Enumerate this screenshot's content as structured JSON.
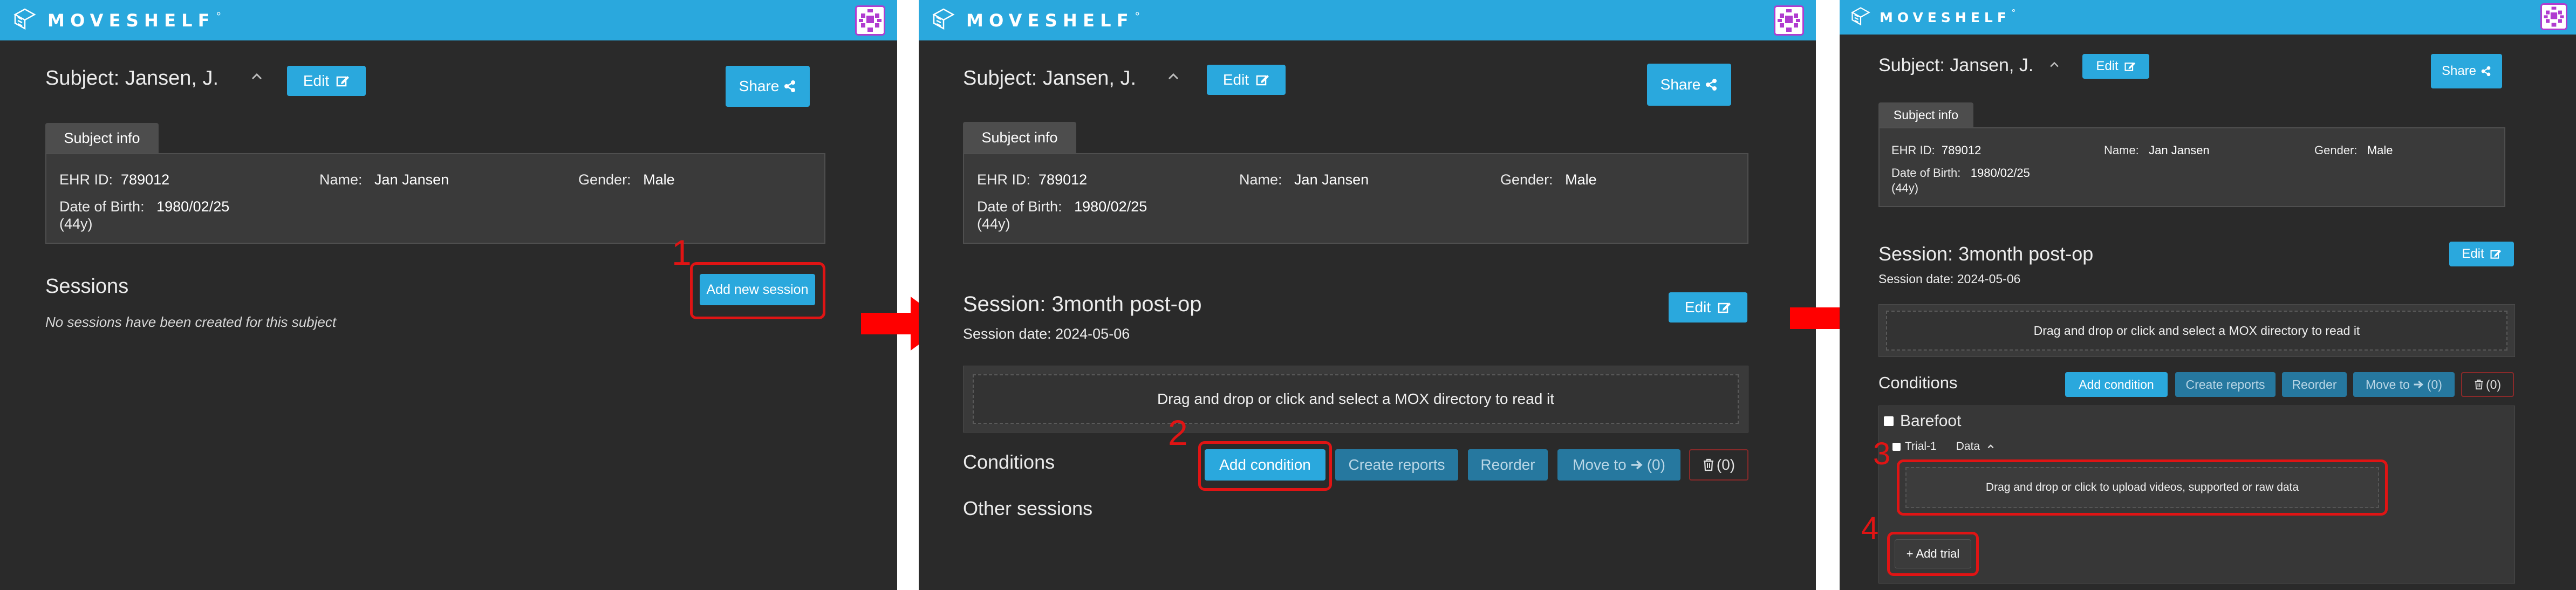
{
  "app": {
    "brand": "MOVESHELF",
    "brand_mark": "°"
  },
  "icons": {
    "logo": "moveshelf-logo-icon",
    "edit": "edit-icon",
    "share": "share-icon",
    "collapse": "chevron-up-icon",
    "arrow": "arrow-right-icon",
    "trash": "trash-icon"
  },
  "colors": {
    "navbar": "#2aa8dd",
    "background": "#2a2a2a",
    "highlight": "#e01414"
  },
  "panel1": {
    "subject_title": "Subject: Jansen, J.",
    "edit_label": "Edit",
    "share_label": "Share",
    "tab_label": "Subject info",
    "info": {
      "ehr_label": "EHR ID:",
      "ehr_value": "789012",
      "name_label": "Name:",
      "name_value": "Jan Jansen",
      "gender_label": "Gender:",
      "gender_value": "Male",
      "dob_label": "Date of Birth:",
      "dob_value": "1980/02/25",
      "age": "(44y)"
    },
    "sessions_heading": "Sessions",
    "no_sessions": "No sessions have been created for this subject",
    "add_session_label": "Add new session",
    "step": "1"
  },
  "panel2": {
    "subject_title": "Subject: Jansen, J.",
    "edit_label": "Edit",
    "share_label": "Share",
    "tab_label": "Subject info",
    "info": {
      "ehr_label": "EHR ID:",
      "ehr_value": "789012",
      "name_label": "Name:",
      "name_value": "Jan Jansen",
      "gender_label": "Gender:",
      "gender_value": "Male",
      "dob_label": "Date of Birth:",
      "dob_value": "1980/02/25",
      "age": "(44y)"
    },
    "session_title": "Session: 3month post-op",
    "session_date": "Session date: 2024-05-06",
    "session_edit_label": "Edit",
    "dropzone_text": "Drag and drop or click and select a MOX directory to read it",
    "conditions_heading": "Conditions",
    "add_condition_label": "Add condition",
    "create_reports_label": "Create reports",
    "reorder_label": "Reorder",
    "move_to_label": "Move to",
    "move_to_count": "(0)",
    "delete_count": "(0)",
    "other_sessions": "Other sessions",
    "step": "2"
  },
  "panel3": {
    "subject_title": "Subject: Jansen, J.",
    "edit_label": "Edit",
    "share_label": "Share",
    "tab_label": "Subject info",
    "info": {
      "ehr_label": "EHR ID:",
      "ehr_value": "789012",
      "name_label": "Name:",
      "name_value": "Jan Jansen",
      "gender_label": "Gender:",
      "gender_value": "Male",
      "dob_label": "Date of Birth:",
      "dob_value": "1980/02/25",
      "age": "(44y)"
    },
    "session_title": "Session: 3month post-op",
    "session_date": "Session date: 2024-05-06",
    "session_edit_label": "Edit",
    "dropzone_text": "Drag and drop or click and select a MOX directory to read it",
    "conditions_heading": "Conditions",
    "add_condition_label": "Add condition",
    "create_reports_label": "Create reports",
    "reorder_label": "Reorder",
    "move_to_label": "Move to",
    "move_to_count": "(0)",
    "delete_count": "(0)",
    "condition_name": "Barefoot",
    "trial_name": "Trial-1",
    "data_label": "Data",
    "upload_text": "Drag and drop or click to upload videos, supported or raw data",
    "add_trial_label": "+ Add trial",
    "step3": "3",
    "step4": "4"
  }
}
